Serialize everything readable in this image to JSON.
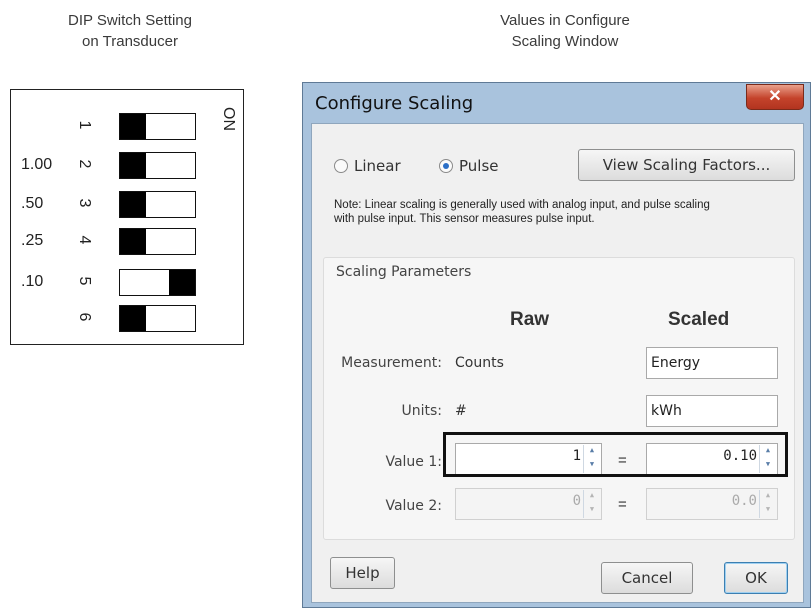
{
  "captions": {
    "left": [
      "DIP Switch Setting",
      "on Transducer"
    ],
    "right": [
      "Values in Configure",
      "Scaling Window"
    ]
  },
  "dip": {
    "on_label": "ON",
    "rows": [
      {
        "num": "1",
        "value": "",
        "state": "off"
      },
      {
        "num": "2",
        "value": "1.00",
        "state": "off"
      },
      {
        "num": "3",
        "value": ".50",
        "state": "off"
      },
      {
        "num": "4",
        "value": ".25",
        "state": "off"
      },
      {
        "num": "5",
        "value": ".10",
        "state": "on"
      },
      {
        "num": "6",
        "value": "",
        "state": "off"
      }
    ]
  },
  "dialog": {
    "title": "Configure Scaling",
    "close_icon": "close-x-icon",
    "radio_linear": "Linear",
    "radio_pulse": "Pulse",
    "selected_mode": "Pulse",
    "view_button": "View Scaling Factors...",
    "note": "Note: Linear scaling is generally used with analog input, and pulse scaling with pulse input. This sensor measures pulse input.",
    "group_label": "Scaling Parameters",
    "col_raw": "Raw",
    "col_scaled": "Scaled",
    "measurement_label": "Measurement:",
    "measurement_raw": "Counts",
    "measurement_scaled": "Energy",
    "units_label": "Units:",
    "units_raw": "#",
    "units_scaled": "kWh",
    "value1_label": "Value 1:",
    "value1_raw": "1",
    "value1_scaled": "0.10",
    "value2_label": "Value 2:",
    "value2_raw": "0",
    "value2_scaled": "0.0",
    "equals": "=",
    "help_button": "Help",
    "cancel_button": "Cancel",
    "ok_button": "OK"
  }
}
